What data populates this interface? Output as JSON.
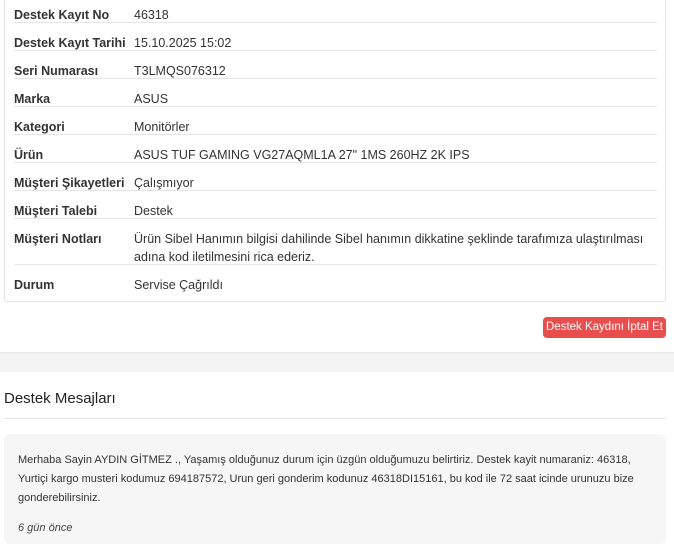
{
  "details": {
    "rows": [
      {
        "label": "Destek Kayıt No",
        "value": "46318"
      },
      {
        "label": "Destek Kayıt Tarihi",
        "value": "15.10.2025 15:02"
      },
      {
        "label": "Seri Numarası",
        "value": "T3LMQS076312"
      },
      {
        "label": "Marka",
        "value": "ASUS"
      },
      {
        "label": "Kategori",
        "value": "Monitörler"
      },
      {
        "label": "Ürün",
        "value": "ASUS TUF GAMING VG27AQML1A 27\" 1MS 260HZ 2K IPS"
      },
      {
        "label": "Müşteri Şikayetleri",
        "value": "Çalışmıyor"
      },
      {
        "label": "Müşteri Talebi",
        "value": "Destek"
      },
      {
        "label": "Müşteri Notları",
        "value": "Ürün Sibel Hanımın bilgisi dahilinde Sibel hanımın dikkatine şeklinde tarafımıza ulaştırılması adına kod iletilmesini rica ederiz."
      },
      {
        "label": "Durum",
        "value": "Servise Çağrıldı"
      }
    ]
  },
  "actions": {
    "cancel_label": "Destek Kaydını İptal Et",
    "cancel_color": "#e94e4e"
  },
  "messages": {
    "title": "Destek Mesajları",
    "items": [
      {
        "text": "Merhaba Sayin AYDIN GİTMEZ ., Yaşamış olduğunuz durum için üzgün olduğumuzu belirtiriz. Destek kayit numaraniz: 46318, Yurtiçi kargo musteri kodumuz 694187572, Urun geri gonderim kodunuz 46318DI15161, bu kod ile 72 saat icinde urunuzu bize gonderebilirsiniz.",
        "time": "6 gün önce"
      }
    ]
  }
}
